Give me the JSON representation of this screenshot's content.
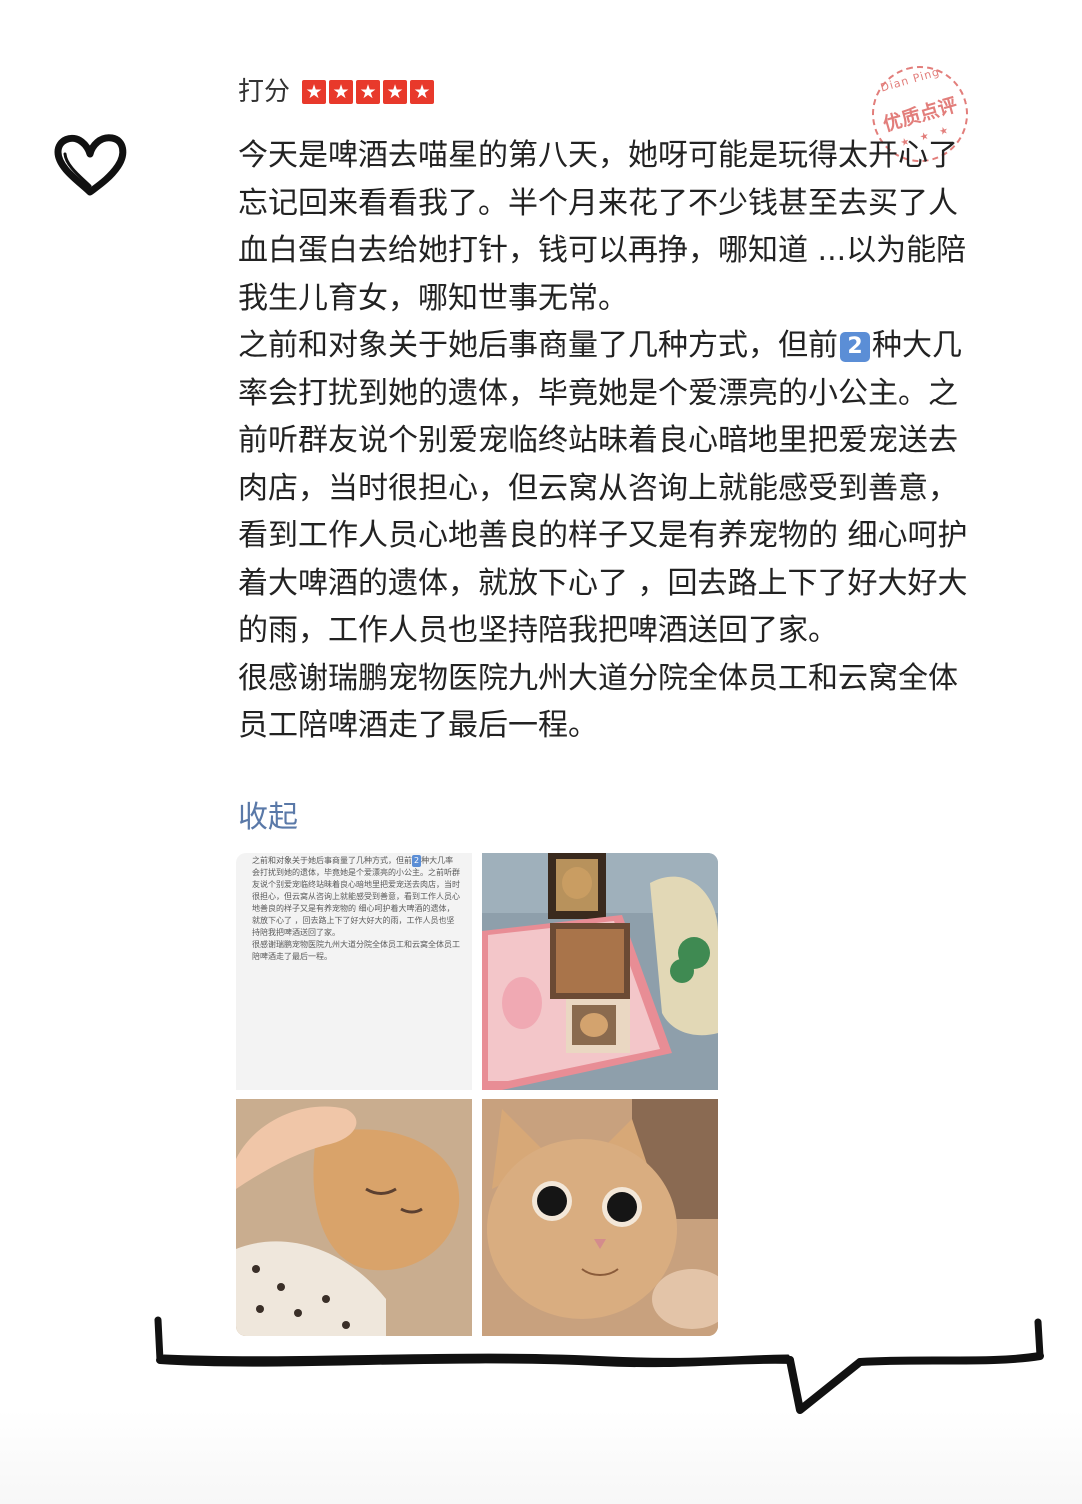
{
  "review": {
    "rating_label": "打分",
    "stars": [
      "★",
      "★",
      "★",
      "★",
      "★"
    ],
    "star_count": 5,
    "star_color": "#e8392b",
    "stamp": {
      "top_text": "Dian Ping",
      "main_text": "优质点评",
      "bottom_text": "★ ★ ★"
    },
    "paragraph_1": "今天是啤酒去喵星的第八天，她呀可能是玩得太开心了 忘记回来看看我了。半个月来花了不少钱甚至去买了人血白蛋白去给她打针，钱可以再挣，哪知道 ...以为能陪我生儿育女，哪知世事无常。",
    "paragraph_2_before": "之前和对象关于她后事商量了几种方式，但前",
    "paragraph_2_badge": "2",
    "paragraph_2_after": "种大几率会打扰到她的遗体，毕竟她是个爱漂亮的小公主。之前听群友说个别爱宠临终站昧着良心暗地里把爱宠送去肉店，当时很担心，但云窝从咨询上就能感受到善意，看到工作人员心地善良的样子又是有养宠物的 细心呵护着大啤酒的遗体，就放下心了 ，回去路上下了好大好大的雨，工作人员也坚持陪我把啤酒送回了家。",
    "paragraph_3": "很感谢瑞鹏宠物医院九州大道分院全体员工和云窝全体员工陪啤酒走了最后一程。",
    "collapse_label": "收起",
    "link_color": "#5a79a8"
  },
  "photos": {
    "screenshot_text_1": "之前和对象关于她后事商量了几种方式，但前",
    "screenshot_badge": "2",
    "screenshot_text_2": "种大几率会打扰到她的遗体，毕竟她是个爱漂亮的小公主。之前听群友说个别爱宠临终站昧着良心暗地里把爱宠送去肉店，当时很担心，但云窝从咨询上就能感受到善意，看到工作人员心地善良的样子又是有养宠物的 细心呵护着大啤酒的遗体，就放下心了 ，回去路上下了好大好大的雨，工作人员也坚持陪我把啤酒送回了家。",
    "screenshot_text_3": "很感谢瑞鹏宠物医院九州大道分院全体员工和云窝全体员工陪啤酒走了最后一程。"
  },
  "decorations": {
    "heart_icon": "heart-outline-icon",
    "speech_bubble_scribble": "hand-drawn-speech-bubble-tail"
  }
}
